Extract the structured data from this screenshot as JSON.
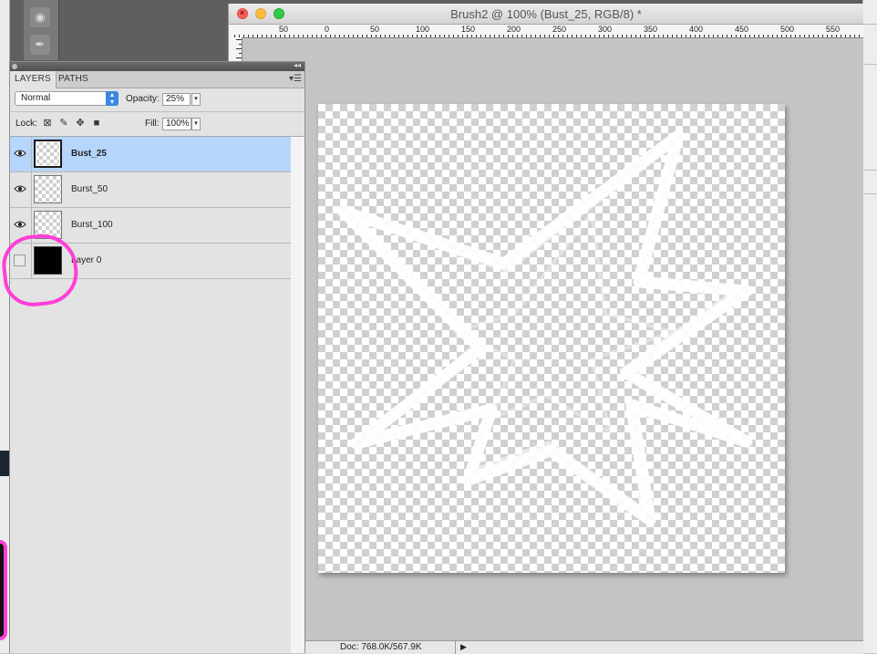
{
  "document": {
    "title": "Brush2 @ 100% (Bust_25, RGB/8) *",
    "ruler_ticks": [
      "50",
      "0",
      "50",
      "100",
      "150",
      "200",
      "250",
      "300",
      "350",
      "400",
      "450",
      "500",
      "550"
    ],
    "status_text": "Doc: 768.0K/567.9K"
  },
  "layers_panel": {
    "tabs": [
      {
        "label": "LAYERS",
        "active": true
      },
      {
        "label": "PATHS",
        "active": false
      }
    ],
    "blend_mode": "Normal",
    "opacity_label": "Opacity:",
    "opacity_value": "25%",
    "lock_label": "Lock:",
    "fill_label": "Fill:",
    "fill_value": "100%",
    "layers": [
      {
        "name": "Bust_25",
        "visible": true,
        "selected": true,
        "thumb": "transparent"
      },
      {
        "name": "Burst_50",
        "visible": true,
        "selected": false,
        "thumb": "transparent"
      },
      {
        "name": "Burst_100",
        "visible": true,
        "selected": false,
        "thumb": "transparent"
      },
      {
        "name": "Layer 0",
        "visible": false,
        "selected": false,
        "thumb": "black"
      }
    ]
  },
  "colors": {
    "annotation": "#ff3fd8",
    "selection": "#b5d5fb",
    "blend_arrow": "#3b86e0"
  },
  "icons": {
    "lock_icons": [
      "lock-transparent-pixels-icon",
      "lock-image-pixels-icon",
      "lock-position-icon",
      "lock-all-icon"
    ],
    "eye": "eye-icon",
    "panel_menu": "panel-menu-icon"
  }
}
